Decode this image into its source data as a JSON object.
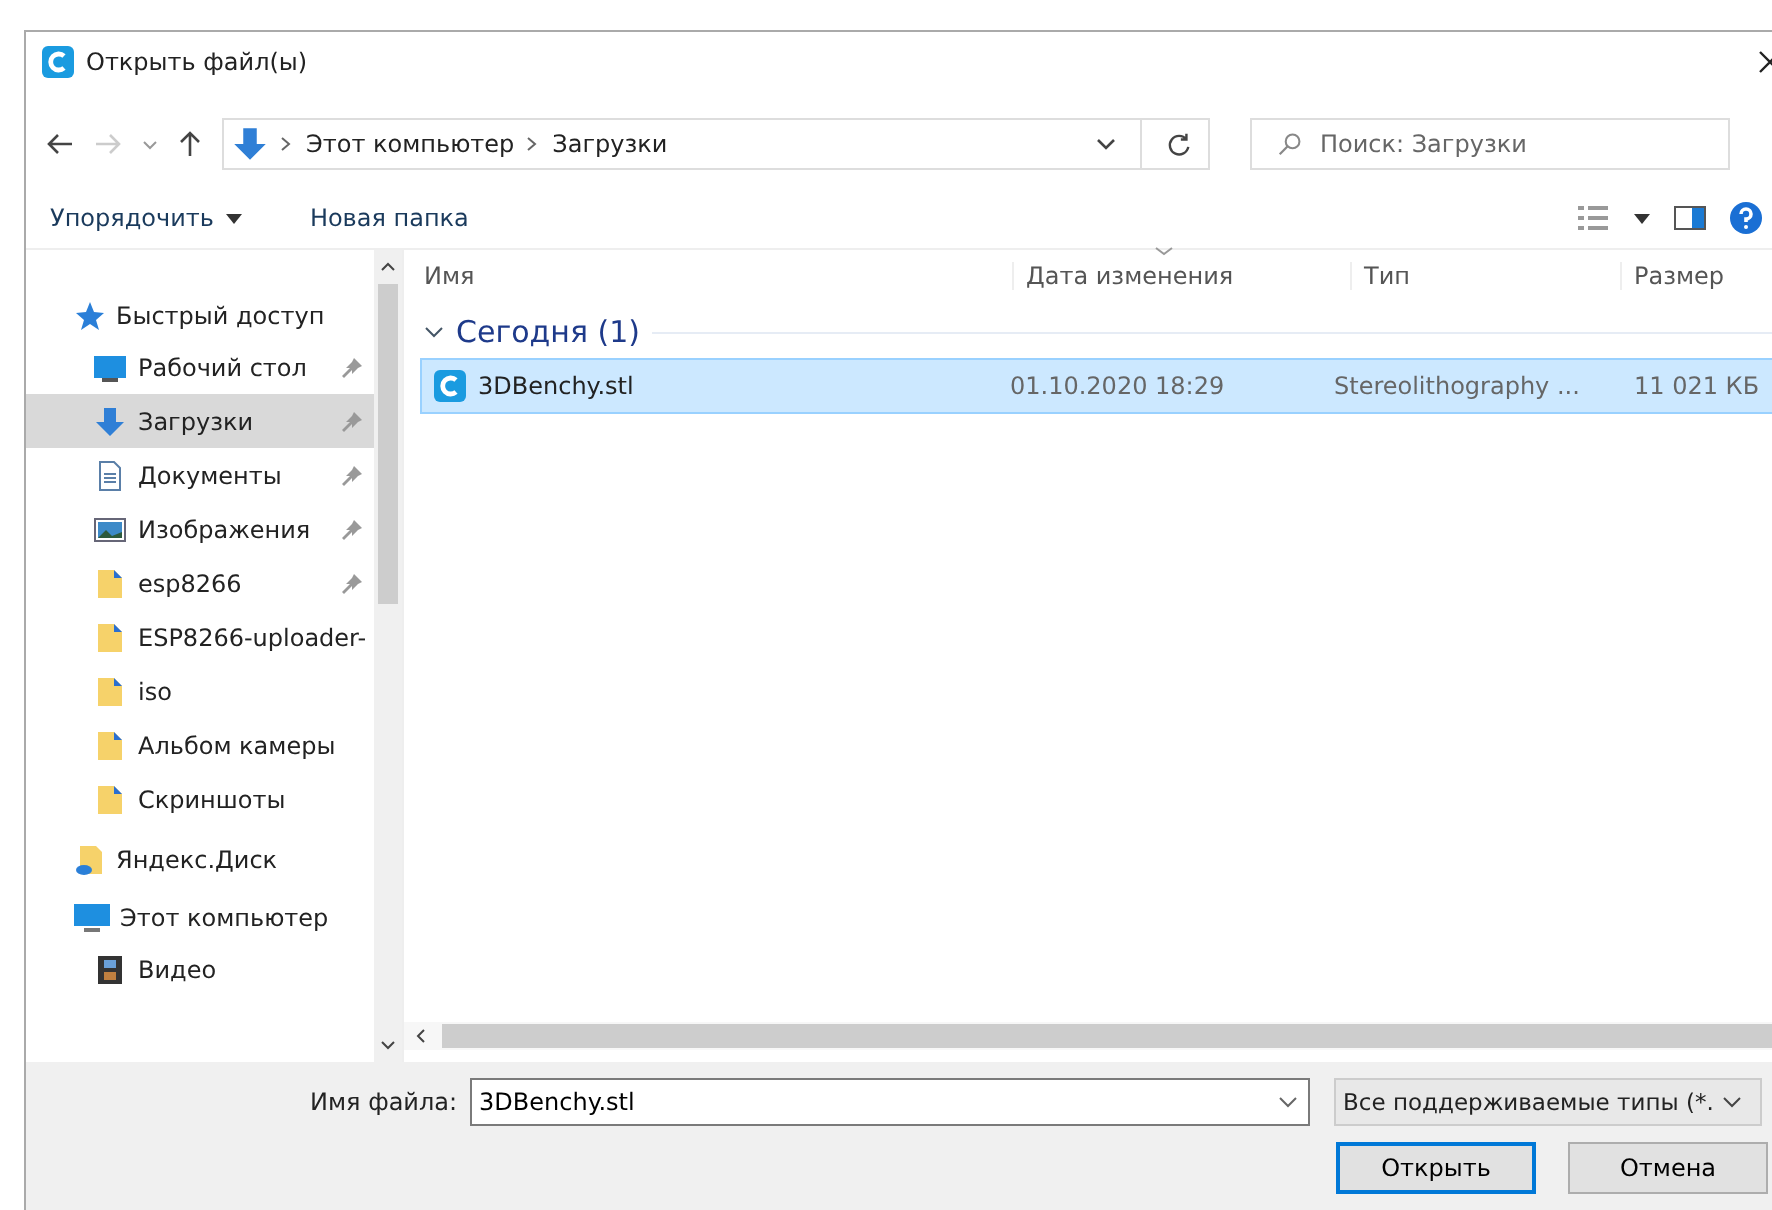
{
  "window": {
    "title": "Открыть файл(ы)"
  },
  "address": {
    "path": [
      "Этот компьютер",
      "Загрузки"
    ]
  },
  "search": {
    "placeholder": "Поиск: Загрузки"
  },
  "toolbar": {
    "organize": "Упорядочить",
    "new_folder": "Новая папка"
  },
  "sidebar": {
    "sections": [
      {
        "label": "Быстрый доступ",
        "children": [
          {
            "label": "Рабочий стол",
            "pinned": true,
            "selected": false
          },
          {
            "label": "Загрузки",
            "pinned": true,
            "selected": true
          },
          {
            "label": "Документы",
            "pinned": true,
            "selected": false
          },
          {
            "label": "Изображения",
            "pinned": true,
            "selected": false
          },
          {
            "label": "esp8266",
            "pinned": true,
            "selected": false
          },
          {
            "label": "ESP8266-uploader-",
            "pinned": false,
            "selected": false
          },
          {
            "label": "iso",
            "pinned": false,
            "selected": false
          },
          {
            "label": "Альбом камеры",
            "pinned": false,
            "selected": false
          },
          {
            "label": "Скриншоты",
            "pinned": false,
            "selected": false
          }
        ]
      },
      {
        "label": "Яндекс.Диск"
      },
      {
        "label": "Этот компьютер",
        "children": [
          {
            "label": "Видео",
            "pinned": false,
            "selected": false
          }
        ]
      }
    ]
  },
  "table": {
    "columns": [
      "Имя",
      "Дата изменения",
      "Тип",
      "Размер"
    ],
    "groups": [
      {
        "label": "Сегодня (1)",
        "expanded": true,
        "rows": [
          {
            "name": "3DBenchy.stl",
            "date": "01.10.2020 18:29",
            "type": "Stereolithography ...",
            "size": "11 021 КБ",
            "selected": true
          }
        ]
      }
    ]
  },
  "footer": {
    "file_name_label": "Имя файла:",
    "file_name": "3DBenchy.stl",
    "filter": "Все поддерживаемые типы (*.",
    "buttons": [
      "Открыть",
      "Отмена"
    ]
  }
}
